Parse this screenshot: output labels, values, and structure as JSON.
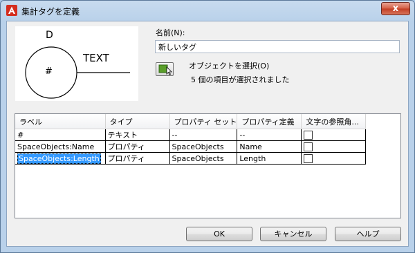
{
  "window": {
    "title": "集計タグを定義",
    "close_glyph": "x"
  },
  "preview": {
    "top_label": "D",
    "center_label": "#",
    "right_label": "TEXT"
  },
  "name": {
    "label": "名前(N):",
    "value": "新しいタグ"
  },
  "objects": {
    "select_label": "オブジェクトを選択(O)",
    "count_text": "5 個の項目が選択されました"
  },
  "table": {
    "columns": [
      "ラベル",
      "タイプ",
      "プロパティ セット",
      "プロパティ定義",
      "文字の参照角..."
    ],
    "rows": [
      {
        "label": "#",
        "type": "テキスト",
        "property_set": "--",
        "property_def": "--",
        "ref_angle_checked": false
      },
      {
        "label": "SpaceObjects:Name",
        "type": "プロパティ",
        "property_set": "SpaceObjects",
        "property_def": "Name",
        "ref_angle_checked": false
      },
      {
        "label": "SpaceObjects:Length",
        "type": "プロパティ",
        "property_set": "SpaceObjects",
        "property_def": "Length",
        "ref_angle_checked": false,
        "selected": true
      }
    ]
  },
  "buttons": {
    "ok": "OK",
    "cancel": "キャンセル",
    "help": "ヘルプ"
  },
  "colors": {
    "selection": "#3399ff",
    "app_icon": "#d42d1e",
    "close": "#c23d23",
    "select_icon": "#5a9e2a"
  }
}
